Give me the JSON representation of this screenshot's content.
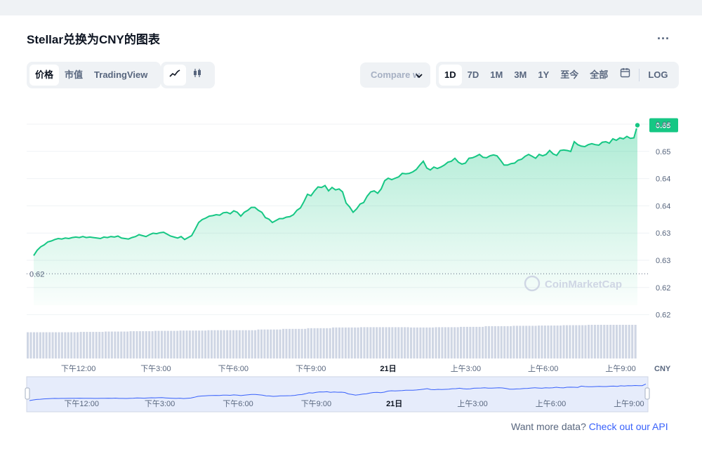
{
  "title": "Stellar兑换为CNY的图表",
  "more_label": "...",
  "view_tabs": [
    "价格",
    "市值",
    "TradingView"
  ],
  "chart_type_icons": [
    "line-chart-icon",
    "candlestick-icon"
  ],
  "compare": {
    "label": "Compare w"
  },
  "ranges": [
    "1D",
    "7D",
    "1M",
    "3M",
    "1Y",
    "至今",
    "全部"
  ],
  "log_label": "LOG",
  "calendar_icon": "calendar-icon",
  "watermark": "CoinMarketCap",
  "footer": {
    "prefix": "Want more data? ",
    "link": "Check out our API"
  },
  "colors": {
    "line": "#16c784",
    "accent": "#3861fb",
    "badge": "#16c784"
  },
  "chart_data": {
    "type": "area",
    "currency": "CNY",
    "current_price_label": "0.65",
    "open_price_label": "0.62",
    "y_tick_labels": [
      "0.65",
      "0.65",
      "0.64",
      "0.64",
      "0.63",
      "0.63",
      "0.62",
      "0.62"
    ],
    "x_tick_labels": [
      "下午12:00",
      "下午3:00",
      "下午6:00",
      "下午9:00",
      "21日",
      "上午3:00",
      "上午6:00",
      "上午9:00"
    ],
    "x_tick_hours": [
      2,
      5,
      8,
      11,
      14,
      17,
      20,
      23
    ],
    "x_range_hours": [
      0,
      23.65
    ],
    "ylim": [
      0.615,
      0.6525
    ],
    "prices": [
      0.6252,
      0.6263,
      0.627,
      0.6274,
      0.628,
      0.6282,
      0.6285,
      0.6287,
      0.6286,
      0.6288,
      0.6287,
      0.6289,
      0.629,
      0.6289,
      0.6291,
      0.6289,
      0.629,
      0.6289,
      0.6288,
      0.6287,
      0.629,
      0.6289,
      0.6291,
      0.629,
      0.6292,
      0.6288,
      0.6287,
      0.6286,
      0.6289,
      0.6291,
      0.6295,
      0.6293,
      0.6291,
      0.6295,
      0.6298,
      0.6297,
      0.6299,
      0.63,
      0.6296,
      0.6292,
      0.629,
      0.6288,
      0.6291,
      0.6285,
      0.6289,
      0.6293,
      0.6306,
      0.632,
      0.6326,
      0.6329,
      0.6333,
      0.6334,
      0.6336,
      0.6335,
      0.634,
      0.6341,
      0.6338,
      0.6344,
      0.6341,
      0.6333,
      0.6341,
      0.6345,
      0.6351,
      0.6351,
      0.6345,
      0.6341,
      0.633,
      0.6327,
      0.632,
      0.6324,
      0.6328,
      0.6328,
      0.6331,
      0.6332,
      0.6336,
      0.6345,
      0.635,
      0.6363,
      0.6378,
      0.6375,
      0.6385,
      0.6393,
      0.6392,
      0.6396,
      0.6385,
      0.6392,
      0.6387,
      0.6389,
      0.6383,
      0.636,
      0.6352,
      0.6341,
      0.6348,
      0.6358,
      0.6361,
      0.6374,
      0.6383,
      0.6385,
      0.638,
      0.6389,
      0.6406,
      0.6411,
      0.6408,
      0.6411,
      0.6414,
      0.6421,
      0.642,
      0.6421,
      0.6424,
      0.6429,
      0.6438,
      0.6446,
      0.6432,
      0.6428,
      0.6434,
      0.6431,
      0.6434,
      0.6438,
      0.6444,
      0.6446,
      0.6452,
      0.6444,
      0.644,
      0.6442,
      0.6452,
      0.6453,
      0.6456,
      0.646,
      0.6454,
      0.6453,
      0.6457,
      0.6459,
      0.6457,
      0.6448,
      0.6438,
      0.6438,
      0.6441,
      0.6442,
      0.6448,
      0.645,
      0.6456,
      0.646,
      0.6456,
      0.6452,
      0.646,
      0.6457,
      0.646,
      0.6468,
      0.6461,
      0.6458,
      0.6468,
      0.6469,
      0.6468,
      0.6466,
      0.6486,
      0.648,
      0.6477,
      0.6476,
      0.648,
      0.6482,
      0.648,
      0.6479,
      0.6485,
      0.6486,
      0.6483,
      0.6492,
      0.6489,
      0.6494,
      0.6492,
      0.6497,
      0.6493,
      0.6494,
      0.652
    ],
    "volume_levels": [
      0.78,
      0.78,
      0.79,
      0.8,
      0.81,
      0.82,
      0.83,
      0.84,
      0.84,
      0.86,
      0.88,
      0.9,
      0.92,
      0.93,
      0.93,
      0.92,
      0.93,
      0.94,
      0.96,
      0.97,
      0.98,
      0.99,
      1.0,
      1.0
    ]
  }
}
